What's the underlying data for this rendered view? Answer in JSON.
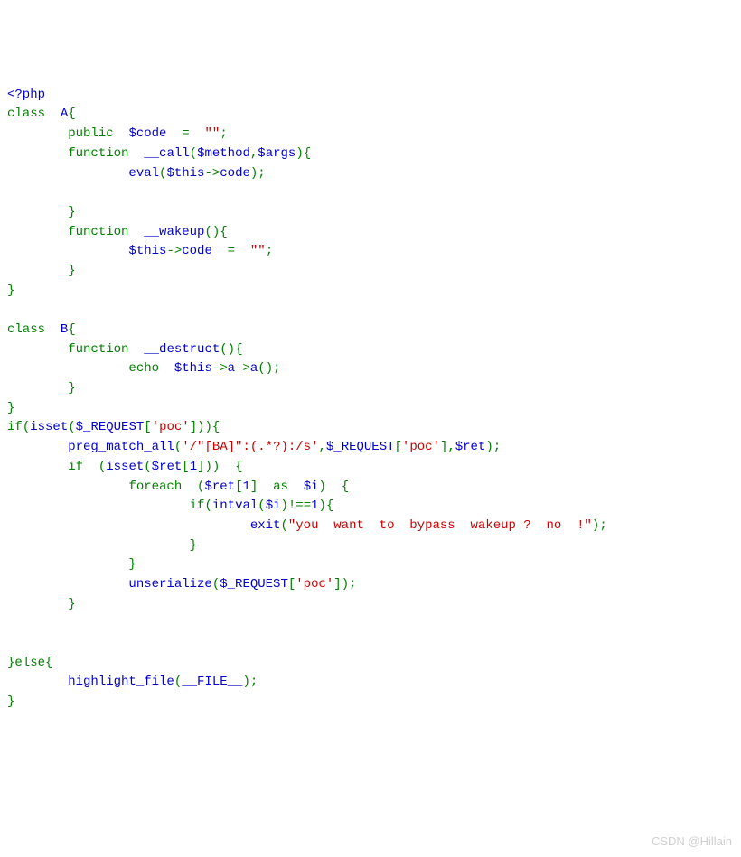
{
  "t": {
    "phpopen": "<?php",
    "class": "class",
    "A": "A",
    "B": "B",
    "public": "public",
    "function": "function",
    "call": "__call",
    "wakeup": "__wakeup",
    "destruct": "__destruct",
    "eval": "eval",
    "echo": "echo",
    "this": "$this",
    "code": "$code",
    "codeprop": "code",
    "method": "$method",
    "args": "$args",
    "aprop": "a",
    "acall": "a",
    "if": "if",
    "else": "else",
    "isset": "isset",
    "req": "$_REQUEST",
    "ret": "$ret",
    "i": "$i",
    "pma": "preg_match_all",
    "foreach": "foreach",
    "as": "as",
    "intval": "intval",
    "exit": "exit",
    "unserialize": "unserialize",
    "hlfile": "highlight_file",
    "FILE": "__FILE__",
    "poc": "'poc'",
    "empty": "\"\"",
    "regex": "'/\"[BA]\":(.*?):/s'",
    "msg": "\"you  want  to  bypass  wakeup ?  no  !\"",
    "one": "1",
    "eq": "=",
    "neq": "!==",
    "arrow": "->",
    "semi": ";",
    "comma": ",",
    "lp": "(",
    "rp": ")",
    "lb": "{",
    "rb": "}",
    "lbr": "[",
    "rbr": "]"
  },
  "watermark": "CSDN @Hillain"
}
